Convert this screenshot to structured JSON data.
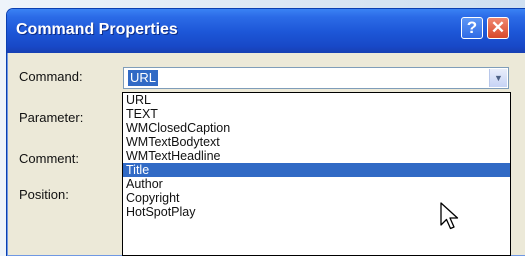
{
  "window": {
    "title": "Command Properties",
    "help_glyph": "?",
    "close_glyph": "✕"
  },
  "form": {
    "command_label": "Command:",
    "parameter_label": "Parameter:",
    "comment_label": "Comment:",
    "position_label": "Position:",
    "command_value": "URL"
  },
  "dropdown": {
    "items": [
      {
        "label": "URL"
      },
      {
        "label": "TEXT"
      },
      {
        "label": "WMClosedCaption"
      },
      {
        "label": "WMTextBodytext"
      },
      {
        "label": "WMTextHeadline"
      },
      {
        "label": "Title"
      },
      {
        "label": "Author"
      },
      {
        "label": "Copyright"
      },
      {
        "label": "HotSpotPlay"
      }
    ],
    "highlighted": "Title"
  },
  "colors": {
    "titlebar": "#1c55d6",
    "selection": "#316ac5",
    "dialog_face": "#ece9d8"
  },
  "icons": {
    "dropdown_arrow": "chevron-down-icon",
    "cursor": "mouse-pointer-icon"
  }
}
